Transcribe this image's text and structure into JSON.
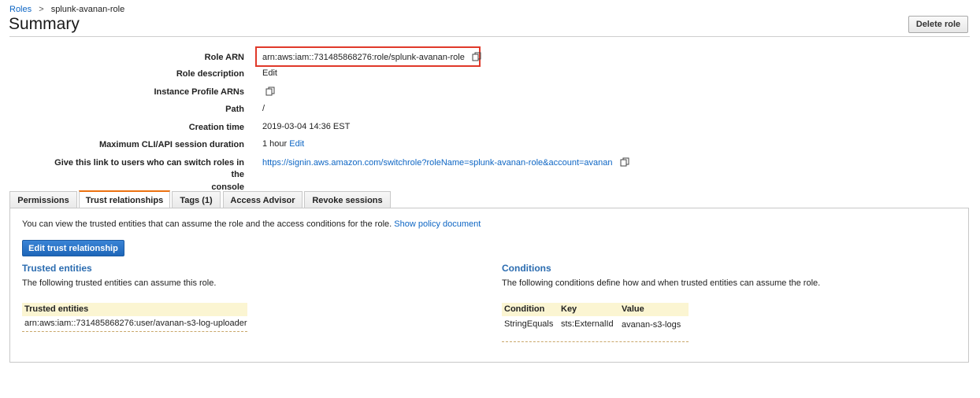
{
  "breadcrumb": {
    "parent": "Roles",
    "separator": ">",
    "current": "splunk-avanan-role"
  },
  "header": {
    "title": "Summary",
    "delete_button": "Delete role"
  },
  "summary": {
    "role_arn_label": "Role ARN",
    "role_arn_value": "arn:aws:iam::731485868276:role/splunk-avanan-role",
    "role_description_label": "Role description",
    "role_description_edit": "Edit",
    "instance_profile_label": "Instance Profile ARNs",
    "path_label": "Path",
    "path_value": "/",
    "creation_time_label": "Creation time",
    "creation_time_value": "2019-03-04 14:36 EST",
    "max_session_label": "Maximum CLI/API session duration",
    "max_session_value": "1 hour",
    "max_session_edit": "Edit",
    "switch_link_label_line1": "Give this link to users who can switch roles in the",
    "switch_link_label_line2": "console",
    "switch_link_value": "https://signin.aws.amazon.com/switchrole?roleName=splunk-avanan-role&account=avanan"
  },
  "tabs": [
    {
      "label": "Permissions",
      "active": false
    },
    {
      "label": "Trust relationships",
      "active": true
    },
    {
      "label": "Tags (1)",
      "active": false
    },
    {
      "label": "Access Advisor",
      "active": false
    },
    {
      "label": "Revoke sessions",
      "active": false
    }
  ],
  "trust": {
    "intro_text": "You can view the trusted entities that can assume the role and the access conditions for the role.",
    "show_policy_link": "Show policy document",
    "edit_button": "Edit trust relationship",
    "entities_title": "Trusted entities",
    "entities_desc": "The following trusted entities can assume this role.",
    "entities_table_header": "Trusted entities",
    "entities_rows": [
      "arn:aws:iam::731485868276:user/avanan-s3-log-uploader"
    ],
    "conditions_title": "Conditions",
    "conditions_desc": "The following conditions define how and when trusted entities can assume the role.",
    "conditions_headers": {
      "condition": "Condition",
      "key": "Key",
      "value": "Value"
    },
    "conditions_rows": [
      {
        "condition": "StringEquals",
        "key": "sts:ExternalId",
        "value": "avanan-s3-logs"
      }
    ]
  },
  "icons": {
    "copy": "copy-icon"
  },
  "colors": {
    "link": "#0e66c4",
    "primary_button": "#2a74c8",
    "highlight_box": "#e0392a",
    "active_tab_accent": "#ec7211",
    "table_header_bg": "#fbf5d2"
  }
}
